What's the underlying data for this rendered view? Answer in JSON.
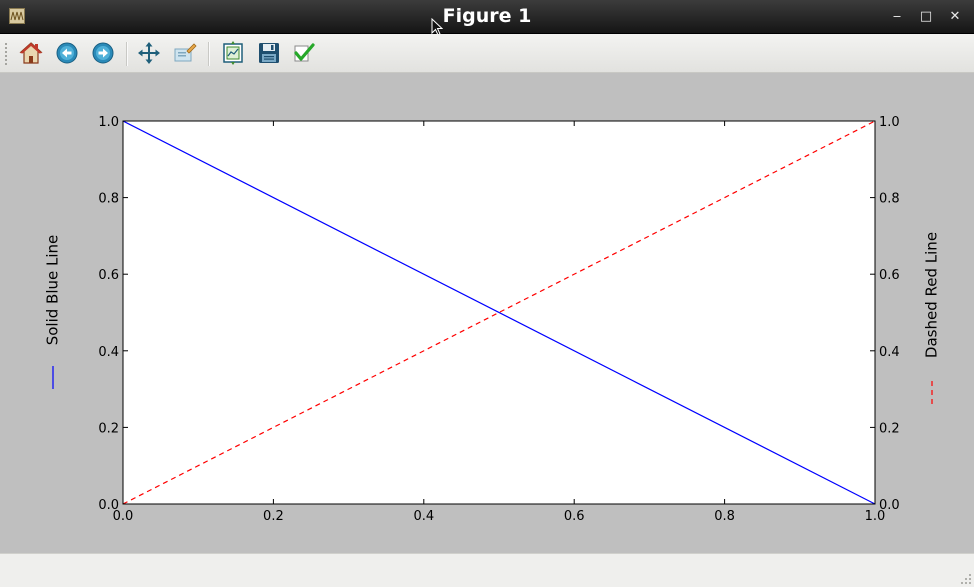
{
  "window": {
    "title": "Figure 1",
    "minimize_label": "‒",
    "maximize_label": "□",
    "close_label": "✕"
  },
  "toolbar": {
    "buttons": [
      {
        "name": "home-button",
        "icon": "home-icon",
        "tooltip": "Reset original view"
      },
      {
        "name": "back-button",
        "icon": "back-arrow-icon",
        "tooltip": "Back to previous view"
      },
      {
        "name": "forward-button",
        "icon": "forward-arrow-icon",
        "tooltip": "Forward to next view"
      },
      {
        "name": "pan-button",
        "icon": "move-icon",
        "tooltip": "Pan axes"
      },
      {
        "name": "zoom-button",
        "icon": "zoom-rect-icon",
        "tooltip": "Zoom to rectangle"
      },
      {
        "name": "subplots-button",
        "icon": "subplots-icon",
        "tooltip": "Configure subplots"
      },
      {
        "name": "save-button",
        "icon": "floppy-disk-icon",
        "tooltip": "Save the figure"
      },
      {
        "name": "customize-button",
        "icon": "checkmark-icon",
        "tooltip": "Edit axis, curve and image parameters"
      }
    ]
  },
  "status": {
    "text": ""
  },
  "colors": {
    "blue_line": "#0000ff",
    "red_line": "#ff0000",
    "figure_bg": "#bfbfbf",
    "axes_bg": "#ffffff"
  },
  "chart_data": {
    "type": "line",
    "title": "",
    "xlabel": "",
    "ylabel": "",
    "xlim": [
      0.0,
      1.0
    ],
    "ylim": [
      0.0,
      1.0
    ],
    "grid": false,
    "x_ticks": [
      "0.0",
      "0.2",
      "0.4",
      "0.6",
      "0.8",
      "1.0"
    ],
    "y_ticks": [
      "0.0",
      "0.2",
      "0.4",
      "0.6",
      "0.8",
      "1.0"
    ],
    "y_ticks_right": [
      "0.0",
      "0.2",
      "0.4",
      "0.6",
      "0.8",
      "1.0"
    ],
    "series": [
      {
        "name": "Solid Blue Line",
        "style": "solid",
        "color": "#0000ff",
        "x": [
          0.0,
          1.0
        ],
        "y": [
          1.0,
          0.0
        ]
      },
      {
        "name": "Dashed Red Line",
        "style": "dashed",
        "color": "#ff0000",
        "x": [
          0.0,
          1.0
        ],
        "y": [
          0.0,
          1.0
        ]
      }
    ],
    "legend": [
      {
        "label": "Solid Blue Line",
        "placement": "left"
      },
      {
        "label": "Dashed Red Line",
        "placement": "right"
      }
    ]
  }
}
